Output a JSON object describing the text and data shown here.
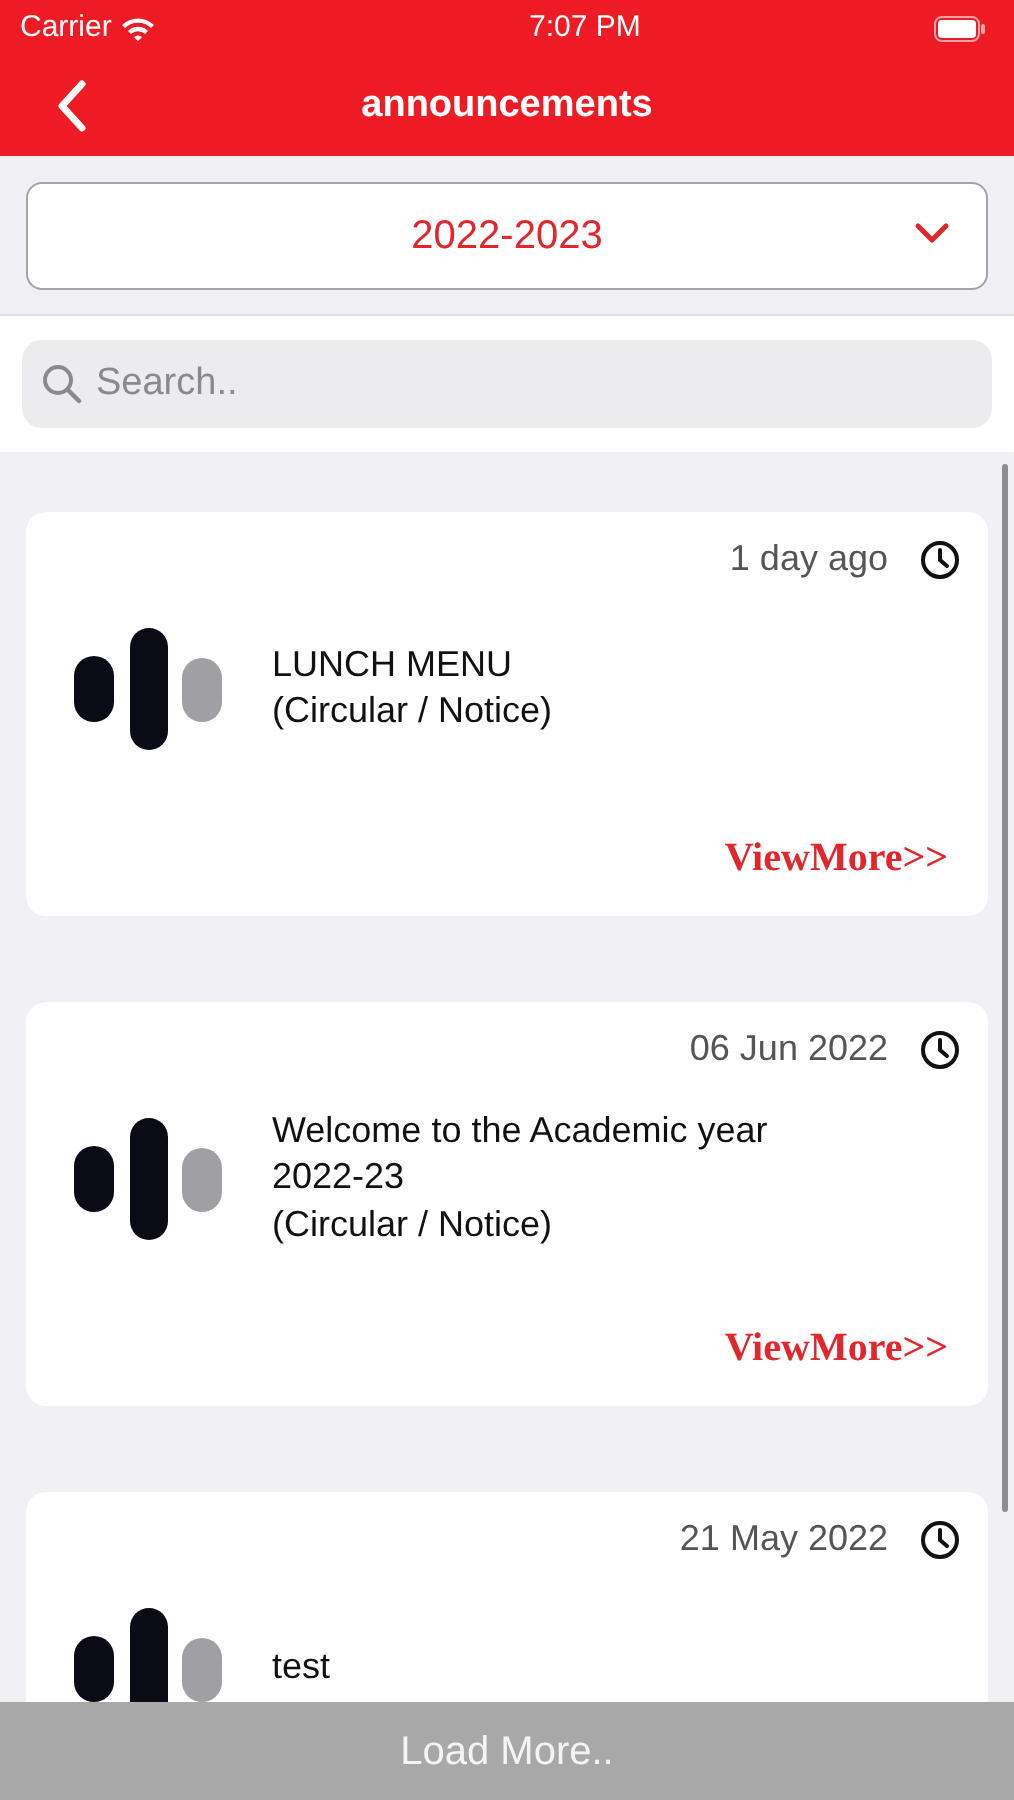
{
  "status_bar": {
    "carrier": "Carrier",
    "time": "7:07 PM"
  },
  "nav": {
    "title": "announcements"
  },
  "year_select": {
    "value": "2022-2023"
  },
  "search": {
    "placeholder": "Search.."
  },
  "announcements": [
    {
      "time": "1 day ago",
      "title": "LUNCH MENU",
      "type": "(Circular / Notice)",
      "link": "ViewMore>>"
    },
    {
      "time": "06 Jun 2022",
      "title": "Welcome to the Academic year 2022-23",
      "type": "(Circular / Notice)",
      "link": "ViewMore>>"
    },
    {
      "time": "21 May 2022",
      "title": "test"
    }
  ],
  "load_more": "Load More.."
}
